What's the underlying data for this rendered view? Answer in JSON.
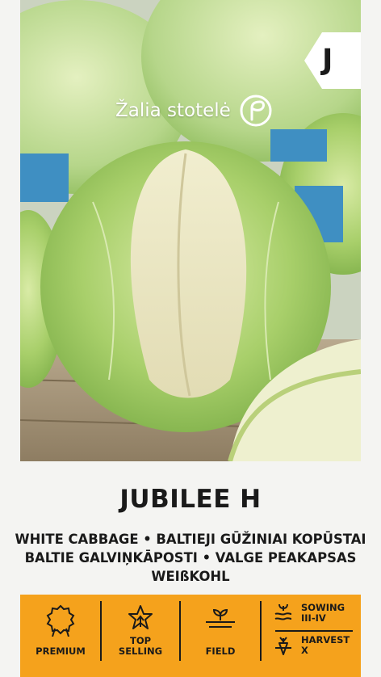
{
  "photo": {
    "description_icon": "cabbage-photo"
  },
  "badge": {
    "letter": "J"
  },
  "brand": {
    "name": "Žalia stotelė",
    "logo_icon": "leaf-circle-logo-icon"
  },
  "product": {
    "title": "JUBILEE H",
    "subtitle_lines": [
      "WHITE CABBAGE • BALTIEJI GŪŽINIAI KOPŪSTAI",
      "BALTIE GALVIŅKĀPOSTI • VALGE PEAKAPSAS",
      "WEIßKOHL"
    ]
  },
  "features": {
    "premium": {
      "label": "PREMIUM",
      "icon": "rosette-icon"
    },
    "top_selling": {
      "label_line1": "TOP",
      "label_line2": "SELLING",
      "icon": "star-arrow-icon"
    },
    "field": {
      "label": "FIELD",
      "icon": "sprout-field-icon"
    },
    "sowing": {
      "label": "SOWING",
      "value": "III-IV",
      "icon": "sowing-icon"
    },
    "harvest": {
      "label": "HARVEST",
      "value": "X",
      "icon": "carrot-harvest-icon"
    }
  },
  "colors": {
    "accent": "#f5a21c",
    "text": "#1a1a1a",
    "background": "#f4f4f2"
  }
}
